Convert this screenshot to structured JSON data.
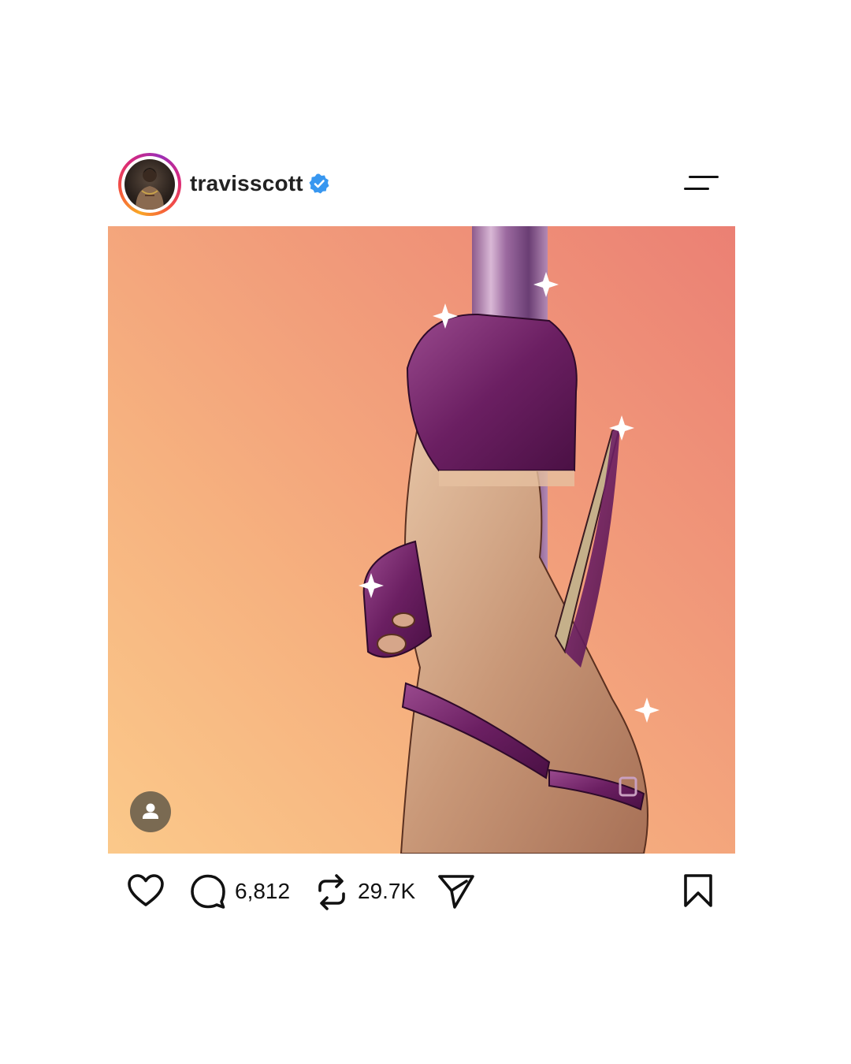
{
  "post": {
    "username": "travisscott",
    "verified": true,
    "avatar_icon": "profile-photo",
    "menu_icon": "menu-icon",
    "image_subject": "illustration",
    "tag_icon": "user-tag-icon"
  },
  "actions": {
    "comments": "6,812",
    "reposts": "29.7K"
  },
  "colors": {
    "verified_blue": "#3897f0",
    "heel_purple": "#6b1f62",
    "background_peach": "#f3a47b"
  }
}
